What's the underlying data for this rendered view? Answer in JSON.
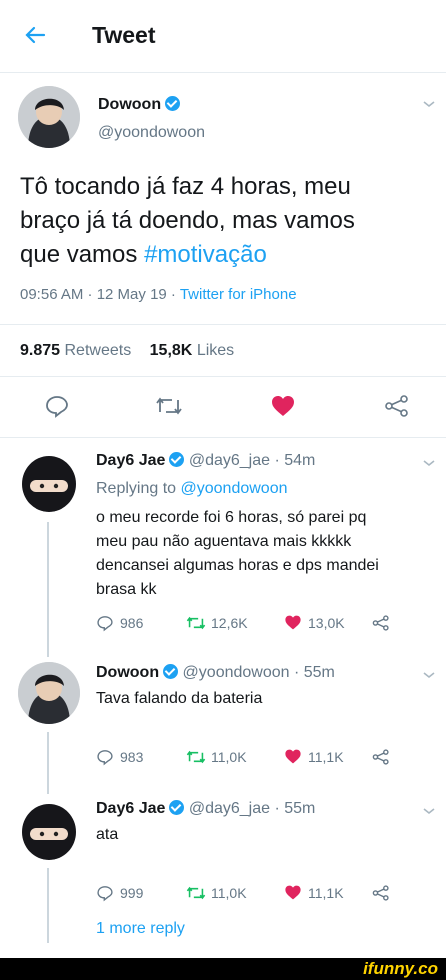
{
  "header": {
    "title": "Tweet"
  },
  "tweet": {
    "name": "Dowoon",
    "handle": "@yoondowoon",
    "text_line1": "Tô tocando já faz 4 horas, meu",
    "text_line2": "braço já tá doendo, mas vamos",
    "text_line3a": "que vamos ",
    "hashtag": "#motivação",
    "meta_time": "09:56 AM · 12 May 19 · ",
    "meta_source": "Twitter for iPhone",
    "retweets_count": "9.875",
    "retweets_label": "Retweets",
    "likes_count": "15,8K",
    "likes_label": "Likes"
  },
  "replies": [
    {
      "name": "Day6 Jae",
      "handle": "@day6_jae · 54m",
      "replying_prefix": "Replying to ",
      "replying_to": "@yoondowoon",
      "lines": [
        "o meu recorde foi 6 horas, só parei pq",
        "meu pau não aguentava mais kkkkk",
        "dencansei algumas horas e dps mandei",
        "brasa kk"
      ],
      "comments": "986",
      "retweets": "12,6K",
      "likes": "13,0K"
    },
    {
      "name": "Dowoon",
      "handle": "@yoondowoon · 55m",
      "lines": [
        "Tava falando da bateria"
      ],
      "comments": "983",
      "retweets": "11,0K",
      "likes": "11,1K"
    },
    {
      "name": "Day6 Jae",
      "handle": "@day6_jae · 55m",
      "lines": [
        "ata"
      ],
      "comments": "999",
      "retweets": "11,0K",
      "likes": "11,1K"
    }
  ],
  "more_replies": "1 more reply",
  "watermark": "ifunny.co",
  "colors": {
    "accent": "#1da1f2",
    "like": "#e0245e",
    "muted": "#657786"
  }
}
